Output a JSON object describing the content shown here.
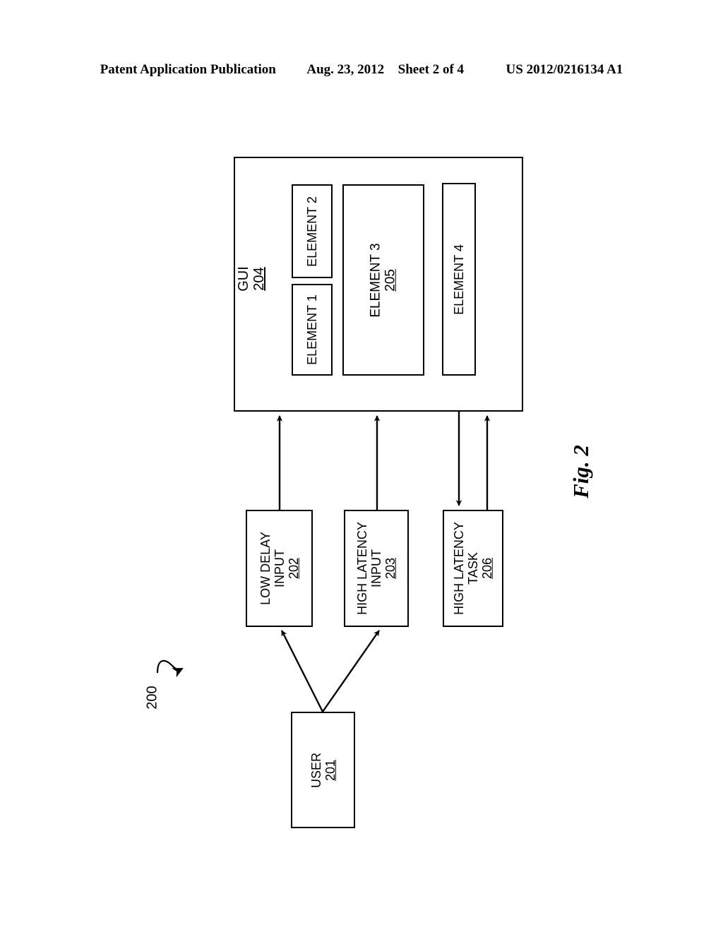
{
  "header": {
    "publication": "Patent Application Publication",
    "date": "Aug. 23, 2012",
    "sheet": "Sheet 2 of 4",
    "patent_number": "US 2012/0216134 A1"
  },
  "figure": {
    "label": "Fig. 2",
    "system_reference": "200"
  },
  "gui": {
    "title": "GUI",
    "ref": "204"
  },
  "elements": [
    {
      "name": "element-1",
      "label": "ELEMENT 1",
      "ref": ""
    },
    {
      "name": "element-2",
      "label": "ELEMENT 2",
      "ref": ""
    },
    {
      "name": "element-3",
      "label": "ELEMENT 3",
      "ref": "205"
    },
    {
      "name": "element-4",
      "label": "ELEMENT 4",
      "ref": ""
    }
  ],
  "nodes": {
    "low_delay_input": {
      "line1": "LOW DELAY",
      "line2": "INPUT",
      "ref": "202"
    },
    "high_latency_input": {
      "line1": "HIGH LATENCY",
      "line2": "INPUT",
      "ref": "203"
    },
    "high_latency_task": {
      "line1": "HIGH LATENCY",
      "line2": "TASK",
      "ref": "206"
    },
    "user": {
      "line1": "USER",
      "ref": "201"
    }
  },
  "colors": {
    "stroke": "#000000",
    "background": "#ffffff"
  }
}
